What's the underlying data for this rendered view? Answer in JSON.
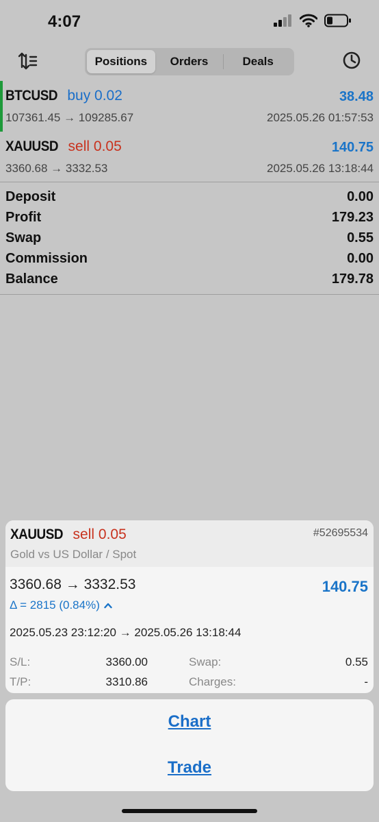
{
  "status_bar": {
    "time": "4:07",
    "icons": [
      "signal-icon",
      "wifi-icon",
      "battery-icon"
    ]
  },
  "toolbar": {
    "tabs": [
      {
        "label": "Positions",
        "active": true
      },
      {
        "label": "Orders",
        "active": false
      },
      {
        "label": "Deals",
        "active": false
      }
    ],
    "left_icon": "sort-icon",
    "right_icon": "history-clock-icon"
  },
  "positions": [
    {
      "symbol": "BTCUSD",
      "side": "buy",
      "volume": "0.02",
      "profit": "38.48",
      "prices": "107361.45 → 109285.67",
      "time": "2025.05.26 01:57:53"
    },
    {
      "symbol": "XAUUSD",
      "side": "sell",
      "volume": "0.05",
      "profit": "140.75",
      "prices": "3360.68 → 3332.53",
      "time": "2025.05.26 13:18:44"
    }
  ],
  "summary": [
    {
      "label": "Deposit",
      "value": "0.00"
    },
    {
      "label": "Profit",
      "value": "179.23"
    },
    {
      "label": "Swap",
      "value": "0.55"
    },
    {
      "label": "Commission",
      "value": "0.00"
    },
    {
      "label": "Balance",
      "value": "179.78"
    }
  ],
  "detail": {
    "symbol": "XAUUSD",
    "side": "sell",
    "volume": "0.05",
    "ticket": "#52695534",
    "description": "Gold vs US Dollar / Spot",
    "prices": "3360.68 → 3332.53",
    "profit": "140.75",
    "delta": "Δ = 2815 (0.84%)",
    "times": "2025.05.23 23:12:20 → 2025.05.26 13:18:44",
    "sl_label": "S/L:",
    "sl_value": "3360.00",
    "tp_label": "T/P:",
    "tp_value": "3310.86",
    "swap_label": "Swap:",
    "swap_value": "0.55",
    "charges_label": "Charges:",
    "charges_value": "-"
  },
  "actions": {
    "chart": "Chart",
    "trade": "Trade"
  },
  "colors": {
    "background": "#c6c6c6",
    "buy": "#1a6ec8",
    "sell": "#c8321e",
    "profit": "#1a74c8",
    "position_marker": "#1e9a3a"
  }
}
